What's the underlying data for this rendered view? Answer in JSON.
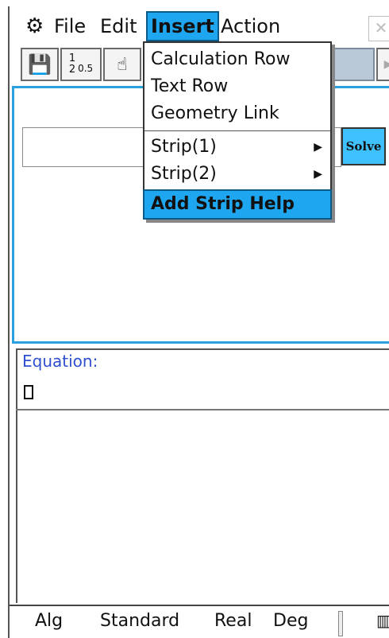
{
  "menubar": {
    "gear_icon": "⚙",
    "file": "File",
    "edit": "Edit",
    "insert": "Insert",
    "action": "Action",
    "close_icon": "✕"
  },
  "toolbar": {
    "save_icon": "💾",
    "frac_top": "1",
    "frac_bottom": "2",
    "decimal": "0.5",
    "hand_icon": "☝",
    "arrow_icon": "▶"
  },
  "solve_button": "Solve",
  "lower": {
    "equation_label": "Equation:"
  },
  "insert_menu": {
    "items": [
      "Calculation Row",
      "Text Row",
      "Geometry Link",
      "Strip(1)",
      "Strip(2)",
      "Add Strip Help"
    ],
    "submenu_arrow": "▶",
    "selected": "Add Strip Help"
  },
  "statusbar": {
    "mode": "Alg",
    "format": "Standard",
    "domain": "Real",
    "angle": "Deg",
    "battery_icon": "▥"
  },
  "colors": {
    "highlight": "#1ea7f0",
    "pane_border": "#2aa0df",
    "solve_bg": "#3fc0ff",
    "equation_label": "#2f4fd0"
  }
}
